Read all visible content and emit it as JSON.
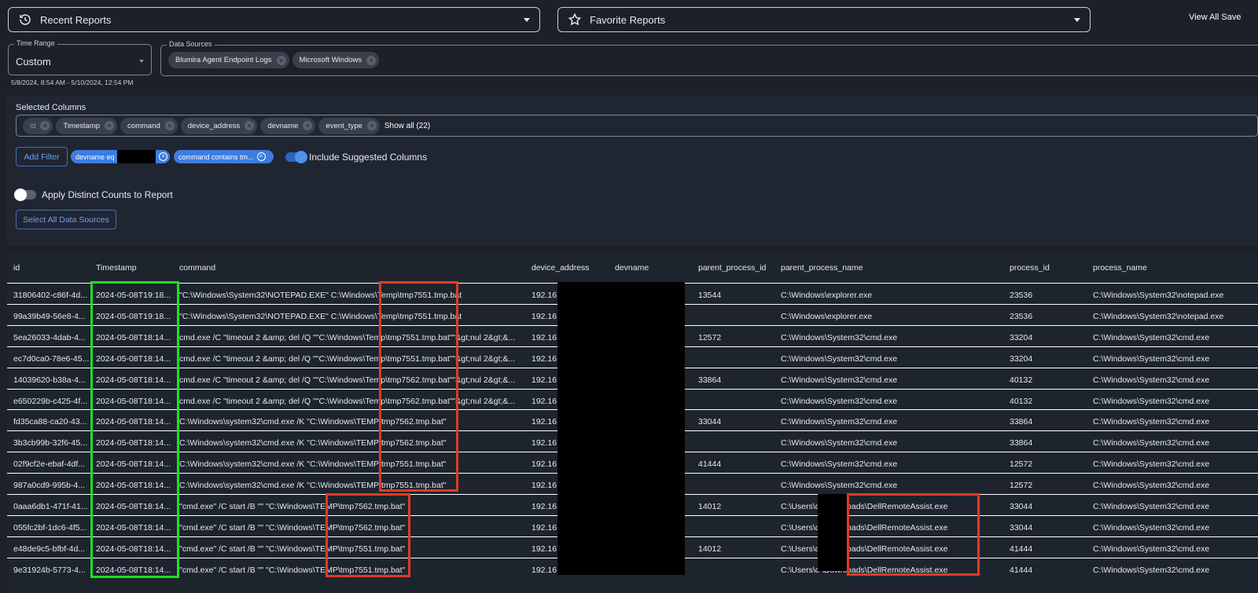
{
  "header": {
    "recent_reports": "Recent Reports",
    "favorite_reports": "Favorite Reports",
    "view_all_saved": "View All Save"
  },
  "time_range": {
    "legend": "Time Range",
    "value": "Custom",
    "range_text": "5/8/2024, 8:54 AM - 5/10/2024, 12:54 PM"
  },
  "data_sources": {
    "legend": "Data Sources",
    "chips": [
      "Blumira Agent Endpoint Logs",
      "Microsoft Windows"
    ]
  },
  "selected_columns": {
    "title": "Selected Columns",
    "chips": [
      "id",
      "Timestamp",
      "command",
      "device_address",
      "devname",
      "event_type"
    ],
    "show_all": "Show all (22)"
  },
  "filters": {
    "add_filter": "Add Filter",
    "chips": [
      "devname eq",
      "command contains tm..."
    ],
    "include_suggested": "Include Suggested Columns",
    "include_suggested_on": true
  },
  "distinct": {
    "label": "Apply Distinct Counts to Report",
    "on": false
  },
  "select_all_button": "Select All Data Sources",
  "table": {
    "columns": [
      "id",
      "Timestamp",
      "command",
      "device_address",
      "devname",
      "parent_process_id",
      "parent_process_name",
      "process_id",
      "process_name"
    ],
    "rows": [
      [
        "31806402-c86f-4d...",
        "2024-05-08T19:18...",
        "\"C:\\Windows\\System32\\NOTEPAD.EXE\" C:\\Windows\\Temp\\tmp7551.tmp.bat",
        "192.16",
        "13544",
        "C:\\Windows\\explorer.exe",
        "23536",
        "C:\\Windows\\System32\\notepad.exe"
      ],
      [
        "99a39b49-56e8-4...",
        "2024-05-08T19:18...",
        "\"C:\\Windows\\System32\\NOTEPAD.EXE\" C:\\Windows\\Temp\\tmp7551.tmp.bat",
        "192.16",
        "",
        "C:\\Windows\\explorer.exe",
        "23536",
        "C:\\Windows\\System32\\notepad.exe"
      ],
      [
        "5ea26033-4dab-4...",
        "2024-05-08T18:14...",
        "cmd.exe /C \"timeout 2 &amp; del /Q \"\"C:\\Windows\\Temp\\tmp7551.tmp.bat\"\"&gt;nul 2&gt;&...",
        "192.16",
        "12572",
        "C:\\Windows\\System32\\cmd.exe",
        "33204",
        "C:\\Windows\\System32\\cmd.exe"
      ],
      [
        "ec7d0ca0-78e6-45...",
        "2024-05-08T18:14...",
        "cmd.exe /C \"timeout 2 &amp; del /Q \"\"C:\\Windows\\Temp\\tmp7551.tmp.bat\"\"&gt;nul 2&gt;&...",
        "192.16",
        "",
        "C:\\Windows\\System32\\cmd.exe",
        "33204",
        "C:\\Windows\\System32\\cmd.exe"
      ],
      [
        "14039620-b38a-4...",
        "2024-05-08T18:14...",
        "cmd.exe /C \"timeout 2 &amp; del /Q \"\"C:\\Windows\\Temp\\tmp7562.tmp.bat\"\"&gt;nul 2&gt;&...",
        "192.16",
        "33864",
        "C:\\Windows\\System32\\cmd.exe",
        "40132",
        "C:\\Windows\\System32\\cmd.exe"
      ],
      [
        "e650229b-c425-4f...",
        "2024-05-08T18:14...",
        "cmd.exe /C \"timeout 2 &amp; del /Q \"\"C:\\Windows\\Temp\\tmp7562.tmp.bat\"\"&gt;nul 2&gt;&...",
        "192.16",
        "",
        "C:\\Windows\\System32\\cmd.exe",
        "40132",
        "C:\\Windows\\System32\\cmd.exe"
      ],
      [
        "fd35ca88-ca20-43...",
        "2024-05-08T18:14...",
        "C:\\Windows\\system32\\cmd.exe /K \"C:\\Windows\\TEMP\\tmp7562.tmp.bat\"",
        "192.16",
        "33044",
        "C:\\Windows\\System32\\cmd.exe",
        "33864",
        "C:\\Windows\\System32\\cmd.exe"
      ],
      [
        "3b3cb99b-32f6-45...",
        "2024-05-08T18:14...",
        "C:\\Windows\\system32\\cmd.exe /K \"C:\\Windows\\TEMP\\tmp7562.tmp.bat\"",
        "192.16",
        "",
        "C:\\Windows\\System32\\cmd.exe",
        "33864",
        "C:\\Windows\\System32\\cmd.exe"
      ],
      [
        "02f9cf2e-ebaf-4df...",
        "2024-05-08T18:14...",
        "C:\\Windows\\system32\\cmd.exe /K \"C:\\Windows\\TEMP\\tmp7551.tmp.bat\"",
        "192.16",
        "41444",
        "C:\\Windows\\System32\\cmd.exe",
        "12572",
        "C:\\Windows\\System32\\cmd.exe"
      ],
      [
        "987a0cd9-995b-4...",
        "2024-05-08T18:14...",
        "C:\\Windows\\system32\\cmd.exe /K \"C:\\Windows\\TEMP\\tmp7551.tmp.bat\"",
        "192.16",
        "",
        "C:\\Windows\\System32\\cmd.exe",
        "12572",
        "C:\\Windows\\System32\\cmd.exe"
      ],
      [
        "0aaa6db1-471f-41...",
        "2024-05-08T18:14...",
        "\"cmd.exe\" /C start /B \"\" \"C:\\Windows\\TEMP\\tmp7562.tmp.bat\"",
        "192.16",
        "14012",
        "C:\\Users\\c                \\Downloads\\DellRemoteAssist.exe",
        "33044",
        "C:\\Windows\\System32\\cmd.exe"
      ],
      [
        "055fc2bf-1dc6-4f5...",
        "2024-05-08T18:14...",
        "\"cmd.exe\" /C start /B \"\" \"C:\\Windows\\TEMP\\tmp7562.tmp.bat\"",
        "192.16",
        "",
        "C:\\Users\\c                \\Downloads\\DellRemoteAssist.exe",
        "33044",
        "C:\\Windows\\System32\\cmd.exe"
      ],
      [
        "e48de9c5-bfbf-4d...",
        "2024-05-08T18:14...",
        "\"cmd.exe\" /C start /B \"\" \"C:\\Windows\\TEMP\\tmp7551.tmp.bat\"",
        "192.16",
        "14012",
        "C:\\Users\\c                \\Downloads\\DellRemoteAssist.exe",
        "41444",
        "C:\\Windows\\System32\\cmd.exe"
      ],
      [
        "9e31924b-5773-4...",
        "2024-05-08T18:14...",
        "\"cmd.exe\" /C start /B \"\" \"C:\\Windows\\TEMP\\tmp7551.tmp.bat\"",
        "192.16",
        "",
        "C:\\Users\\c                \\Downloads\\DellRemoteAssist.exe",
        "41444",
        "C:\\Windows\\System32\\cmd.exe"
      ]
    ]
  }
}
